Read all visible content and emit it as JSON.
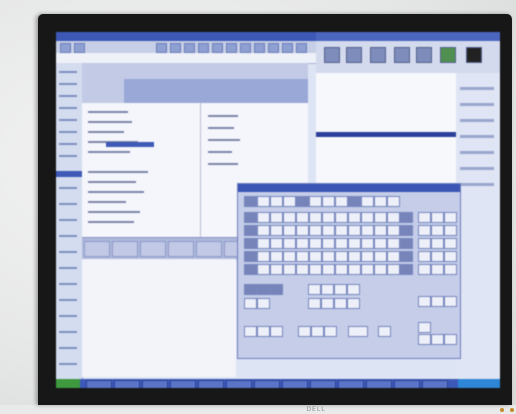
{
  "monitor": {
    "brand": "DELL",
    "bezel_color": "#171717",
    "led_color": "#c58a2c"
  },
  "screen": {
    "desktop_color": "#dde4f3",
    "accent_color": "#3e59b6",
    "taskbar_color": "#3c58b8",
    "start_button_color": "#3f9a3f"
  },
  "windows": [
    {
      "role": "document-window",
      "icon": "document-icon"
    },
    {
      "role": "right-panel-window",
      "icon": "folder-icon"
    },
    {
      "role": "on-screen-keyboard",
      "icon": "keyboard-icon"
    }
  ]
}
